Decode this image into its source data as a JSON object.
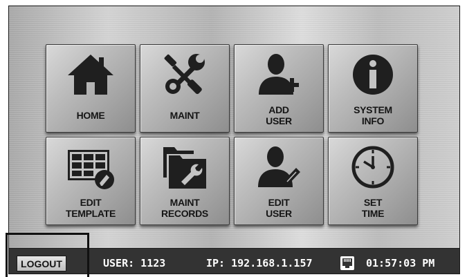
{
  "tiles": [
    {
      "name": "home",
      "icon": "home-icon",
      "lines": [
        "HOME"
      ]
    },
    {
      "name": "maint",
      "icon": "tools-icon",
      "lines": [
        "MAINT"
      ]
    },
    {
      "name": "add-user",
      "icon": "add-user-icon",
      "lines": [
        "ADD",
        "USER"
      ]
    },
    {
      "name": "system-info",
      "icon": "info-icon",
      "lines": [
        "SYSTEM",
        "INFO"
      ]
    },
    {
      "name": "edit-template",
      "icon": "edit-template-icon",
      "lines": [
        "EDIT",
        "TEMPLATE"
      ]
    },
    {
      "name": "maint-records",
      "icon": "maint-records-icon",
      "lines": [
        "MAINT",
        "RECORDS"
      ]
    },
    {
      "name": "edit-user",
      "icon": "edit-user-icon",
      "lines": [
        "EDIT",
        "USER"
      ]
    },
    {
      "name": "set-time",
      "icon": "clock-icon",
      "lines": [
        "SET",
        "TIME"
      ]
    }
  ],
  "status": {
    "logout_label": "LOGOUT",
    "user": "USER: 1123",
    "ip": "IP: 192.168.1.157",
    "network_icon": "network-port-icon",
    "time": "01:57:03 PM"
  }
}
